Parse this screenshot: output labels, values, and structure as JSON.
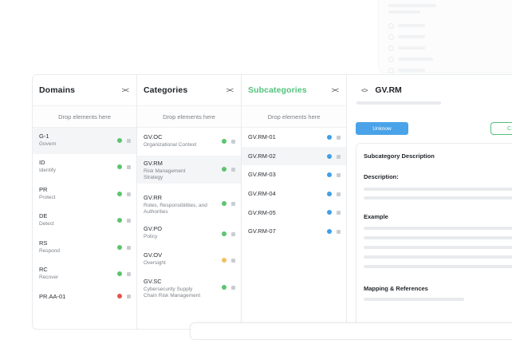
{
  "colors": {
    "active_title": "#53c17d",
    "status_green": "#5cc46f",
    "status_yellow": "#f0c060",
    "status_red": "#e5514b",
    "status_blue": "#3ea0e6",
    "button_blue": "#4aa3e8"
  },
  "panels": {
    "domains": {
      "title": "Domains",
      "collapse_icon": "><",
      "drop_text": "Drop elements here",
      "items": [
        {
          "code": "G-1",
          "name": "Govern",
          "status": "green"
        },
        {
          "code": "ID",
          "name": "Identify",
          "status": "green"
        },
        {
          "code": "PR",
          "name": "Protect",
          "status": "green"
        },
        {
          "code": "DE",
          "name": "Detect",
          "status": "green"
        },
        {
          "code": "RS",
          "name": "Respond",
          "status": "green"
        },
        {
          "code": "RC",
          "name": "Recover",
          "status": "green"
        },
        {
          "code": "PR.AA-01",
          "name": "",
          "status": "red"
        }
      ]
    },
    "categories": {
      "title": "Categories",
      "collapse_icon": "><",
      "drop_text": "Drop elements here",
      "items": [
        {
          "code": "GV.OC",
          "name": "Organizational Context",
          "status": "green"
        },
        {
          "code": "GV.RM",
          "name": "Risk Management Strategy",
          "status": "green"
        },
        {
          "code": "GV.RR",
          "name": "Roles, Responsibilities, and Authorities",
          "status": "green"
        },
        {
          "code": "GV.PO",
          "name": "Policy",
          "status": "green"
        },
        {
          "code": "GV.OV",
          "name": "Oversight",
          "status": "yellow"
        },
        {
          "code": "GV.SC",
          "name": "Cybersecurity Supply Chain Risk Management",
          "status": "green"
        }
      ]
    },
    "subcategories": {
      "title": "Subcategories",
      "collapse_icon": "><",
      "drop_text": "Drop elements here",
      "items": [
        {
          "code": "GV.RM-01",
          "status": "blue"
        },
        {
          "code": "GV.RM-02",
          "status": "blue"
        },
        {
          "code": "GV.RM-03",
          "status": "blue"
        },
        {
          "code": "GV.RM-04",
          "status": "blue"
        },
        {
          "code": "GV.RM-05",
          "status": "blue"
        },
        {
          "code": "GV.RM-07",
          "status": "blue"
        }
      ]
    },
    "detail": {
      "nav_icon": "<>",
      "title": "GV.RM",
      "unknow_button": "Unknow",
      "outline_button": "C",
      "section_subcategory": "Subcategory Description",
      "section_description": "Description:",
      "section_example": "Example",
      "section_mapping": "Mapping & References"
    }
  }
}
